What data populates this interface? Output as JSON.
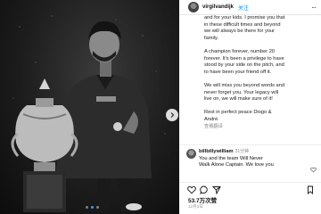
{
  "header": {
    "username": "virgilvandijk",
    "follow_label": "关注",
    "more": "···"
  },
  "caption": {
    "p1": "and for your kids. I promise you that\nin these difficult times and beyond\nwe will always be there for your\nfamily.",
    "p2": "A champion forever, number 20\nforever. It's been a privilege to have\nstood by your side on the pitch, and\nto have been your friend off it.",
    "p3": "We will miss you beyond words and\nnever forget you. Your legacy will\nlive on, we will make sure of it!",
    "p4": "Rest in perfect peace Diogo &\nAndré.",
    "translate": "查看翻译"
  },
  "comment": {
    "username": "billbillywilliam",
    "time": "31分钟",
    "text": "You and the team Will Never\nWalk Alone Captain. We love you"
  },
  "likes": "53.7万次赞",
  "date": "12月3日",
  "icons": {
    "header_more": "more-dots-icon",
    "next": "chevron-right-icon",
    "like": "heart-icon",
    "comment": "comment-bubble-icon",
    "share": "share-send-icon",
    "save": "bookmark-icon"
  },
  "colors": {
    "follow": "#0095f6",
    "carousel_active": "#3d9df3"
  }
}
